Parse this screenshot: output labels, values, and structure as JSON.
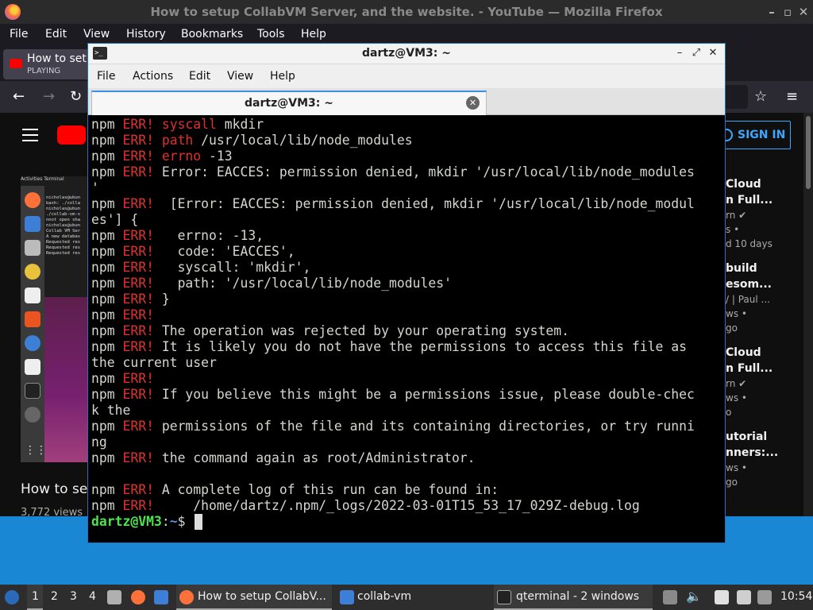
{
  "firefox": {
    "window_title": "How to setup CollabVM Server, and the website. - YouTube — Mozilla Firefox",
    "menu": [
      "File",
      "Edit",
      "View",
      "History",
      "Bookmarks",
      "Tools",
      "Help"
    ],
    "tab": {
      "title": "How to setu",
      "status": "PLAYING"
    }
  },
  "youtube": {
    "sign_in": "SIGN IN",
    "video_title": "How to set",
    "views": "3,772 views •",
    "recommended": [
      {
        "t1": "Cloud",
        "t2": "n Full...",
        "m1": "rn ✔",
        "m2": "s •",
        "m3": "d 10 days"
      },
      {
        "t1": "build",
        "t2": "esom...",
        "m1": "/ | Paul ...",
        "m2": "ws •",
        "m3": "go"
      },
      {
        "t1": "Cloud",
        "t2": "n Full...",
        "m1": "rn ✔",
        "m2": "ws •",
        "m3": "o"
      },
      {
        "t1": "utorial",
        "t2": "nners:...",
        "m1": "",
        "m2": "ws •",
        "m3": "go"
      }
    ],
    "player_terminal_text": "nicholas@ubun\nbash: ./colla\nnicholas@ubun\n./collab-vm-s\nnnot open sha\nnicholas@ubun\nCollab VM Ser\nA new databas\nRequested res\nRequested res\nRequested res",
    "player_topbar": "Activities  Terminal"
  },
  "qterminal": {
    "window_title": "dartz@VM3: ~",
    "menu": [
      "File",
      "Actions",
      "Edit",
      "View",
      "Help"
    ],
    "tab_label": "dartz@VM3: ~",
    "lines": [
      {
        "p": "npm ",
        "e": "ERR! ",
        "r": "",
        "k": "syscall",
        "t": " mkdir"
      },
      {
        "p": "npm ",
        "e": "ERR! ",
        "r": "",
        "k": "path",
        "t": " /usr/local/lib/node_modules"
      },
      {
        "p": "npm ",
        "e": "ERR! ",
        "r": "",
        "k": "errno",
        "t": " -13"
      },
      {
        "p": "npm ",
        "e": "ERR! ",
        "r": "",
        "k": "",
        "t": "Error: EACCES: permission denied, mkdir '/usr/local/lib/node_modules"
      },
      {
        "p": "",
        "e": "",
        "r": "",
        "k": "",
        "t": "'"
      },
      {
        "p": "npm ",
        "e": "ERR! ",
        "r": "",
        "k": "",
        "t": " [Error: EACCES: permission denied, mkdir '/usr/local/lib/node_modul"
      },
      {
        "p": "",
        "e": "",
        "r": "",
        "k": "",
        "t": "es'] {"
      },
      {
        "p": "npm ",
        "e": "ERR! ",
        "r": "",
        "k": "",
        "t": "  errno: -13,"
      },
      {
        "p": "npm ",
        "e": "ERR! ",
        "r": "",
        "k": "",
        "t": "  code: 'EACCES',"
      },
      {
        "p": "npm ",
        "e": "ERR! ",
        "r": "",
        "k": "",
        "t": "  syscall: 'mkdir',"
      },
      {
        "p": "npm ",
        "e": "ERR! ",
        "r": "",
        "k": "",
        "t": "  path: '/usr/local/lib/node_modules'"
      },
      {
        "p": "npm ",
        "e": "ERR! ",
        "r": "",
        "k": "",
        "t": "}"
      },
      {
        "p": "npm ",
        "e": "ERR!",
        "r": "",
        "k": "",
        "t": ""
      },
      {
        "p": "npm ",
        "e": "ERR! ",
        "r": "",
        "k": "",
        "t": "The operation was rejected by your operating system."
      },
      {
        "p": "npm ",
        "e": "ERR! ",
        "r": "",
        "k": "",
        "t": "It is likely you do not have the permissions to access this file as"
      },
      {
        "p": "",
        "e": "",
        "r": "",
        "k": "",
        "t": "the current user"
      },
      {
        "p": "npm ",
        "e": "ERR!",
        "r": "",
        "k": "",
        "t": ""
      },
      {
        "p": "npm ",
        "e": "ERR! ",
        "r": "",
        "k": "",
        "t": "If you believe this might be a permissions issue, please double-chec"
      },
      {
        "p": "",
        "e": "",
        "r": "",
        "k": "",
        "t": "k the"
      },
      {
        "p": "npm ",
        "e": "ERR! ",
        "r": "",
        "k": "",
        "t": "permissions of the file and its containing directories, or try runni"
      },
      {
        "p": "",
        "e": "",
        "r": "",
        "k": "",
        "t": "ng"
      },
      {
        "p": "npm ",
        "e": "ERR! ",
        "r": "",
        "k": "",
        "t": "the command again as root/Administrator."
      },
      {
        "p": "",
        "e": "",
        "r": "",
        "k": "",
        "t": ""
      },
      {
        "p": "npm ",
        "e": "ERR! ",
        "r": "",
        "k": "",
        "t": "A complete log of this run can be found in:"
      },
      {
        "p": "npm ",
        "e": "ERR! ",
        "r": "",
        "k": "",
        "t": "    /home/dartz/.npm/_logs/2022-03-01T15_53_17_029Z-debug.log"
      }
    ],
    "prompt": {
      "user": "dartz@VM3",
      "sep": ":",
      "path": "~",
      "sym": "$ "
    }
  },
  "taskbar": {
    "workspaces": [
      "1",
      "2",
      "3",
      "4"
    ],
    "tasks": [
      {
        "label": "How to setup CollabV..."
      },
      {
        "label": "collab-vm"
      },
      {
        "label": "qterminal - 2 windows"
      }
    ],
    "clock": "10:54"
  },
  "colors": {
    "terminal_bg": "#000000",
    "npm_err_red": "#e0302c",
    "prompt_green": "#4ee44e",
    "prompt_blue": "#5a8fe0",
    "desktop_band": "#1987d4",
    "youtube_red": "#ff0000"
  }
}
